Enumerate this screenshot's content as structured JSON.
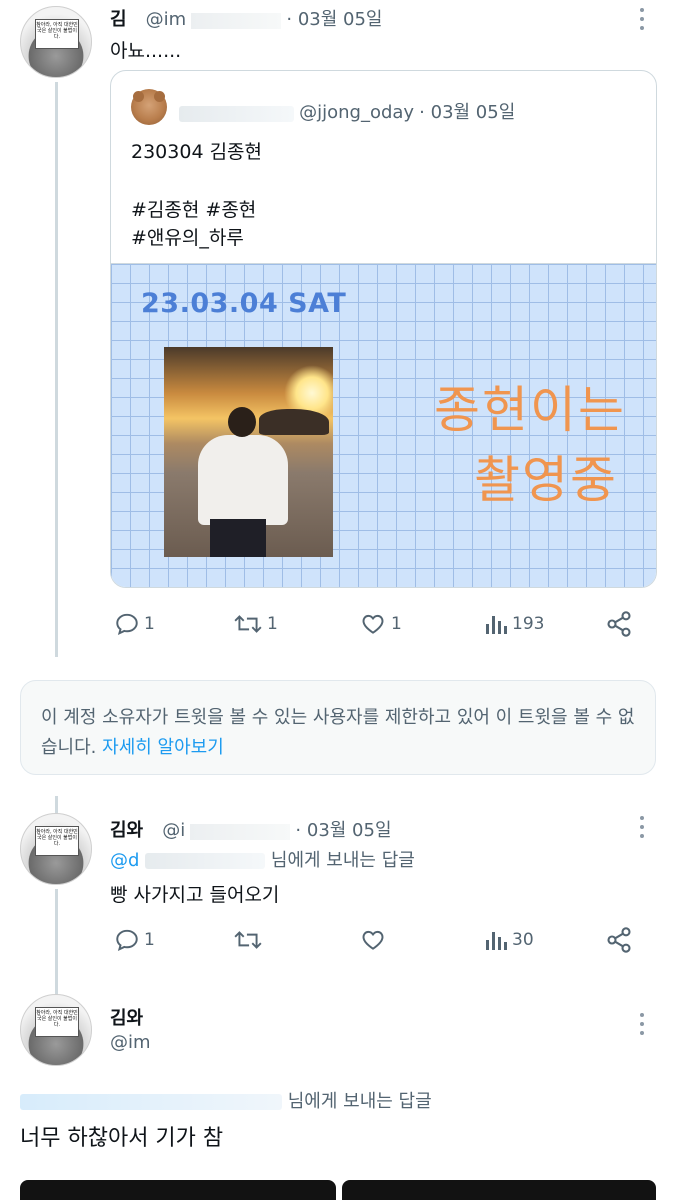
{
  "tweet1": {
    "name": "김",
    "handle": "@im",
    "time": "· 03월 05일",
    "text": "아뇨......",
    "quote": {
      "handle": "@jjong_oday",
      "time": "· 03월 05일",
      "line1": "230304 김종현",
      "line2": "#김종현 #종현",
      "line3": "#앤유의_하루",
      "image": {
        "date_stamp": "23.03.04 SAT",
        "side_line1": "종현이는",
        "side_line2": "촬영중"
      }
    },
    "actions": {
      "reply": "1",
      "retweet": "1",
      "like": "1",
      "views": "193"
    }
  },
  "avatar_sign": "참아라, 아직 대한민국은 살인이 불법이다.",
  "notice": {
    "text": "이 계정 소유자가 트윗을 볼 수 있는 사용자를 제한하고 있어 이 트윗을 볼 수 없습니다.",
    "link": "자세히 알아보기"
  },
  "tweet2": {
    "name": "김와",
    "handle": "@i",
    "time": "· 03월 05일",
    "reply_to_prefix": "@d",
    "reply_to_suffix": "님에게 보내는 답글",
    "text": "빵 사가지고 들어오기",
    "actions": {
      "reply": "1",
      "retweet": "",
      "like": "",
      "views": "30"
    }
  },
  "tweet3": {
    "name": "김와",
    "handle": "@im",
    "reply_to_suffix": "님에게 보내는 답글",
    "text": "너무 하찮아서 기가 참"
  },
  "colors": {
    "accent": "#1d9bf0",
    "secondary": "#536471",
    "date_stamp": "#4c7fd6",
    "side_text": "#f0954f"
  }
}
